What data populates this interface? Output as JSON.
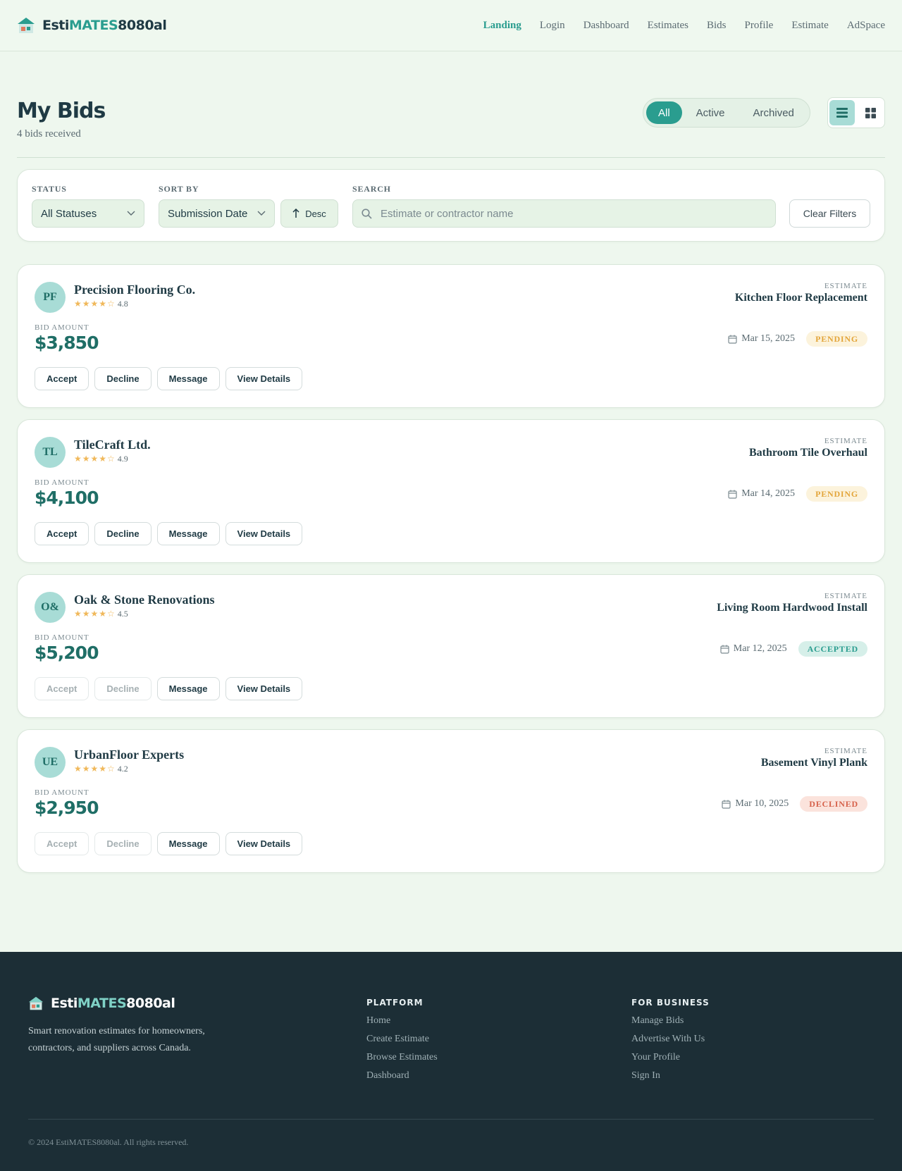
{
  "brand": {
    "prefix": "Esti",
    "mid": "MATES",
    "suffix": "8080al"
  },
  "nav": [
    {
      "label": "Landing",
      "active": true
    },
    {
      "label": "Login"
    },
    {
      "label": "Dashboard"
    },
    {
      "label": "Estimates"
    },
    {
      "label": "Bids"
    },
    {
      "label": "Profile"
    },
    {
      "label": "Estimate"
    },
    {
      "label": "AdSpace"
    }
  ],
  "page": {
    "title": "My Bids",
    "subtitle": "4 bids received"
  },
  "tabs": [
    "All",
    "Active",
    "Archived"
  ],
  "view_toggle": {
    "selected": "list",
    "icons": [
      "list-icon",
      "grid-icon"
    ]
  },
  "filters": {
    "status_label": "STATUS",
    "status_value": "All Statuses",
    "sort_label": "SORT BY",
    "sort_value": "Submission Date",
    "sort_dir": "Desc",
    "search_label": "SEARCH",
    "search_placeholder": "Estimate or contractor name",
    "search_value": "",
    "clear_label": "Clear Filters"
  },
  "bids": [
    {
      "initials": "PF",
      "contractor": "Precision Flooring Co.",
      "stars": "★★★★☆",
      "rating": "4.8",
      "estimate_label": "ESTIMATE",
      "estimate": "Kitchen Floor Replacement",
      "amount_label": "BID AMOUNT",
      "amount": "$3,850",
      "date": "Mar 15, 2025",
      "status": "PENDING"
    },
    {
      "initials": "TL",
      "contractor": "TileCraft Ltd.",
      "stars": "★★★★☆",
      "rating": "4.9",
      "estimate_label": "ESTIMATE",
      "estimate": "Bathroom Tile Overhaul",
      "amount_label": "BID AMOUNT",
      "amount": "$4,100",
      "date": "Mar 14, 2025",
      "status": "PENDING"
    },
    {
      "initials": "O&",
      "contractor": "Oak & Stone Renovations",
      "stars": "★★★★☆",
      "rating": "4.5",
      "estimate_label": "ESTIMATE",
      "estimate": "Living Room Hardwood Install",
      "amount_label": "BID AMOUNT",
      "amount": "$5,200",
      "date": "Mar 12, 2025",
      "status": "ACCEPTED"
    },
    {
      "initials": "UE",
      "contractor": "UrbanFloor Experts",
      "stars": "★★★★☆",
      "rating": "4.2",
      "estimate_label": "ESTIMATE",
      "estimate": "Basement Vinyl Plank",
      "amount_label": "BID AMOUNT",
      "amount": "$2,950",
      "date": "Mar 10, 2025",
      "status": "DECLINED"
    }
  ],
  "bid_actions": [
    "Accept",
    "Decline",
    "Message",
    "View Details"
  ],
  "footer": {
    "description": "Smart renovation estimates for homeowners, contractors, and suppliers across Canada.",
    "platform_heading": "PLATFORM",
    "platform_links": [
      "Home",
      "Create Estimate",
      "Browse Estimates",
      "Dashboard"
    ],
    "business_heading": "FOR BUSINESS",
    "business_links": [
      "Manage Bids",
      "Advertise With Us",
      "Your Profile",
      "Sign In"
    ],
    "copyright": "© 2024 EstiMATES8080al. All rights reserved."
  },
  "colors": {
    "accent": "#2a9d8f",
    "background": "#eef7ee",
    "footer_bg": "#1c2e36",
    "pending": "#e3a53a",
    "accepted": "#2a9d8f",
    "declined": "#d6614a"
  }
}
